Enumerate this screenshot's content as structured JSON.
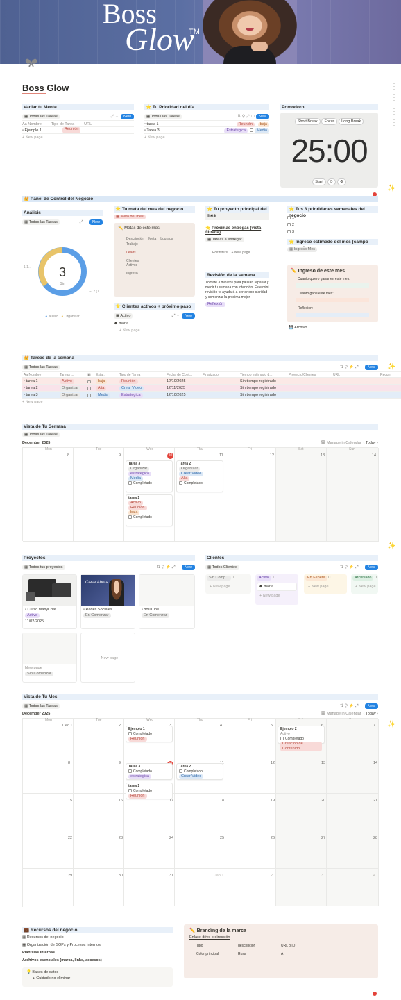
{
  "banner": {
    "title_line1": "Boss",
    "title_line2": "Glow",
    "trademark": "TM"
  },
  "page": {
    "title": "Boss Glow"
  },
  "vaciar": {
    "title": "Vaciar tu Mente",
    "view": "Todas las Tareas",
    "new": "New",
    "columns": [
      "Aa Nombre",
      "Tipo de Tarea",
      "URL"
    ],
    "rows": [
      {
        "name": "Ejemplo 1",
        "tag": "Reunión"
      }
    ],
    "new_page": "+ New page"
  },
  "prioridad": {
    "title": "Tu Prioridad del día",
    "view": "Todas las Tareas",
    "new": "New",
    "rows": [
      {
        "name": "tarea 1",
        "tag1": "Reunión",
        "tag2": "baja"
      },
      {
        "name": "Tarea 3",
        "tag1": "Estrategica",
        "tag2": "Media"
      }
    ],
    "new_page": "+ New page"
  },
  "pomodoro": {
    "title": "Pomodoro",
    "buttons": [
      "Short Break",
      "Focus",
      "Long Break"
    ],
    "time": "25:00",
    "start": "Start"
  },
  "panel": {
    "title": "Panel de Control del Negocio"
  },
  "analisis": {
    "title": "Análisis",
    "view": "Todas las Tareas",
    "new": "New",
    "count": "3",
    "count_label": "Sin",
    "left_label": "1 1...",
    "right_label": "--- 2 (1...",
    "legend": [
      "Nuevo",
      "Organizar"
    ]
  },
  "meta": {
    "title": "Tu meta del mes del negocio",
    "chip": "Meta del mes",
    "card_title": "Metas de este mes",
    "cols": [
      "Descripción",
      "Meta",
      "Lograda"
    ],
    "rows": [
      "Trabajo",
      "Leads",
      "Clientes Activos",
      "Ingreso"
    ]
  },
  "clientes_activos": {
    "title": "Clientes activos + próximo paso",
    "view": "Activo",
    "new": "New",
    "item": "maria",
    "new_page": "+ New page"
  },
  "proyecto": {
    "title": "Tu proyecto principal del mes",
    "entregas_title": "Próximas entregas (vista filtrada)",
    "entregas_view": "Tareas a entregar",
    "edit": "Edit filters",
    "new_page": "+ New page"
  },
  "revision": {
    "title": "Revisión de la semana",
    "text": "Tómate 3 minutos para pausar, repasar y medir tu semana con intención. Este mini revisión te ayudará a cerrar con claridad y comenzar la próxima mejor.",
    "button": "Reflexión"
  },
  "prioridades": {
    "title": "Tus 3 prioridades semanales del negocio",
    "items": [
      "1",
      "2",
      "3"
    ]
  },
  "ingreso_estimado": {
    "title": "Ingreso estimado del mes (campo manual)",
    "chip": "Ingreso Mes"
  },
  "ingreso": {
    "title": "Ingreso de este mes",
    "q1": "Cuanto quiero ganar en este mes:",
    "q2": "Cuanto gane este mes:",
    "q3": "Reflexion:",
    "archivo": "Archivo"
  },
  "semana_tareas": {
    "title": "Tareas de la semana",
    "view": "Todas las Tareas",
    "new": "New",
    "columns": [
      "Aa Nombre",
      "Tareas ...",
      "",
      "Esta...",
      "Tipo de Tarea",
      "Fecha de Cont...",
      "Finalizado",
      "Tiempo estimado d...",
      "Proyecto/Clientes",
      "URL",
      "Recurr"
    ],
    "rows": [
      {
        "name": "tarea 1",
        "estado": "Activo",
        "prioridad": "baja",
        "tipo": "Reunión",
        "fecha": "12/10/2025",
        "tiempo": "Sin tiempo registrado"
      },
      {
        "name": "tarea 2",
        "estado": "Organizar",
        "prioridad": "Alta",
        "tipo": "Crear Video",
        "fecha": "12/11/2025",
        "tiempo": "Sin tiempo registrado"
      },
      {
        "name": "tarea 3",
        "estado": "Organizar",
        "prioridad": "Media",
        "tipo": "Estrategica",
        "fecha": "12/10/2025",
        "tiempo": "Sin tiempo registrado"
      }
    ],
    "new_page": "+ New page"
  },
  "vista_semana": {
    "title": "Vista de Tu Semana",
    "view": "Todas las Tareas",
    "month": "December 2025",
    "manage": "Manage in Calendar",
    "today": "Today",
    "days": [
      "Mon",
      "Tue",
      "Wed",
      "Thu",
      "Fri",
      "Sat",
      "Sun"
    ],
    "nums": [
      "8",
      "9",
      "10",
      "11",
      "12",
      "13",
      "14"
    ],
    "cards": [
      {
        "title": "Tarea 3",
        "tags": [
          "Organizar",
          "estrategica",
          "Media"
        ],
        "check": "Completado"
      },
      {
        "title": "tarea 1",
        "tags": [
          "Activo",
          "Reunión",
          "baja"
        ],
        "check": "Completado"
      },
      {
        "title": "Tarea 2",
        "tags": [
          "Organizar",
          "Crear Video",
          "Alta"
        ],
        "check": "Completado"
      }
    ]
  },
  "proyectos": {
    "title": "Proyectos",
    "view": "Todos tus proyectos",
    "new": "New",
    "cards": [
      {
        "name": "Curso ManyChat",
        "chip": "Activo",
        "date": "11/02/2025"
      },
      {
        "name": "Redes Sociales",
        "chip": "En Comenzar"
      },
      {
        "name": "YouTube",
        "chip": "En Comenzar"
      },
      {
        "name": "New page",
        "chip": "Sin Comenzar"
      }
    ],
    "new_page": "+ New page",
    "thumb_text": "Clase Ahora"
  },
  "clientes": {
    "title": "Clientes",
    "view": "Todos Clientes",
    "new": "New",
    "columns": [
      {
        "label": "Sin Comp...",
        "count": "0"
      },
      {
        "label": "Activo",
        "count": "1"
      },
      {
        "label": "En Espera",
        "count": "0"
      },
      {
        "label": "Archivado",
        "count": "0"
      }
    ],
    "card": "maria",
    "new_page": "+ New page"
  },
  "vista_mes": {
    "title": "Vista de Tu Mes",
    "view": "Todas las Tareas",
    "month": "December 2025",
    "manage": "Manage in Calendar",
    "today": "Today",
    "days": [
      "Mon",
      "Tue",
      "Wed",
      "Thu",
      "Fri",
      "Sat",
      "Sun"
    ],
    "weeks": [
      [
        "Dec 1",
        "2",
        "3",
        "4",
        "5",
        "6",
        "7"
      ],
      [
        "8",
        "9",
        "10",
        "11",
        "12",
        "13",
        "14"
      ],
      [
        "15",
        "16",
        "17",
        "18",
        "19",
        "20",
        "21"
      ],
      [
        "22",
        "23",
        "24",
        "25",
        "26",
        "27",
        "28"
      ],
      [
        "29",
        "30",
        "31",
        "Jan 1",
        "2",
        "3",
        "4"
      ]
    ],
    "ejemplo1": {
      "title": "Ejemplo 1",
      "check": "Completado",
      "tag": "Reunión"
    },
    "ejemplo2": {
      "title": "Ejemplo 2",
      "sub": "Activo",
      "check": "Completado",
      "tag": "Creación de Contenido"
    },
    "tarea3": {
      "title": "Tarea 3",
      "check": "Completado",
      "tag": "estrategica"
    },
    "tarea2": {
      "title": "Tarea 2",
      "check": "Completado",
      "tag": "Crear Video"
    },
    "tarea1": {
      "title": "tarea 1",
      "check": "Completado",
      "tag": "Reunión"
    }
  },
  "recursos": {
    "title": "Recursos del negocio",
    "items": [
      "Recursos del negocio",
      "Organización de SOPs y Procesos Internos"
    ],
    "bold1": "Plantillas internas",
    "bold2": "Archivos esenciales (marca, links, accesos)",
    "callout_title": "Bases de datos",
    "callout_item": "Cuidado no eliminar"
  },
  "branding": {
    "title": "Branding de la marca",
    "sub": "Enlace drive o dirección",
    "cols": [
      "Tipo",
      "descripción",
      "URL o ID"
    ],
    "row": [
      "Color principal",
      "Rosa",
      "A"
    ]
  },
  "colors": {
    "accent": "#2383e2",
    "header_bg": "#e8f0f9",
    "donut_blue": "#5b9ee6",
    "donut_yellow": "#e8c46a"
  }
}
